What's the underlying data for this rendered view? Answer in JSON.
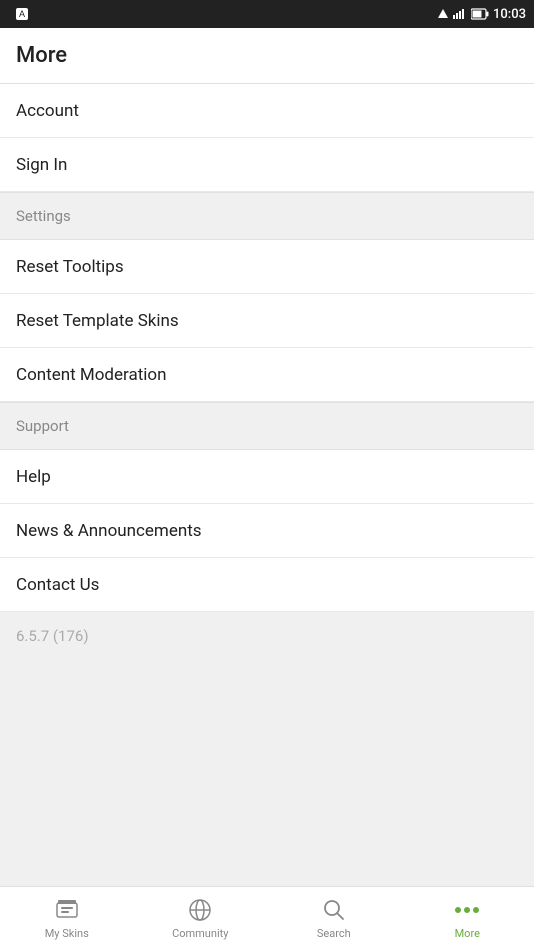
{
  "statusBar": {
    "time": "10:03"
  },
  "header": {
    "title": "More"
  },
  "menu": {
    "items": [
      {
        "label": "Account",
        "type": "item"
      },
      {
        "label": "Sign In",
        "type": "item"
      },
      {
        "label": "Settings",
        "type": "section"
      },
      {
        "label": "Reset Tooltips",
        "type": "item"
      },
      {
        "label": "Reset Template Skins",
        "type": "item"
      },
      {
        "label": "Content Moderation",
        "type": "item"
      },
      {
        "label": "Support",
        "type": "section"
      },
      {
        "label": "Help",
        "type": "item"
      },
      {
        "label": "News & Announcements",
        "type": "item"
      },
      {
        "label": "Contact Us",
        "type": "item"
      }
    ],
    "version": "6.5.7 (176)"
  },
  "bottomNav": {
    "items": [
      {
        "label": "My Skins",
        "icon": "skins-icon",
        "active": false
      },
      {
        "label": "Community",
        "icon": "community-icon",
        "active": false
      },
      {
        "label": "Search",
        "icon": "search-icon",
        "active": false
      },
      {
        "label": "More",
        "icon": "more-icon",
        "active": true
      }
    ]
  }
}
